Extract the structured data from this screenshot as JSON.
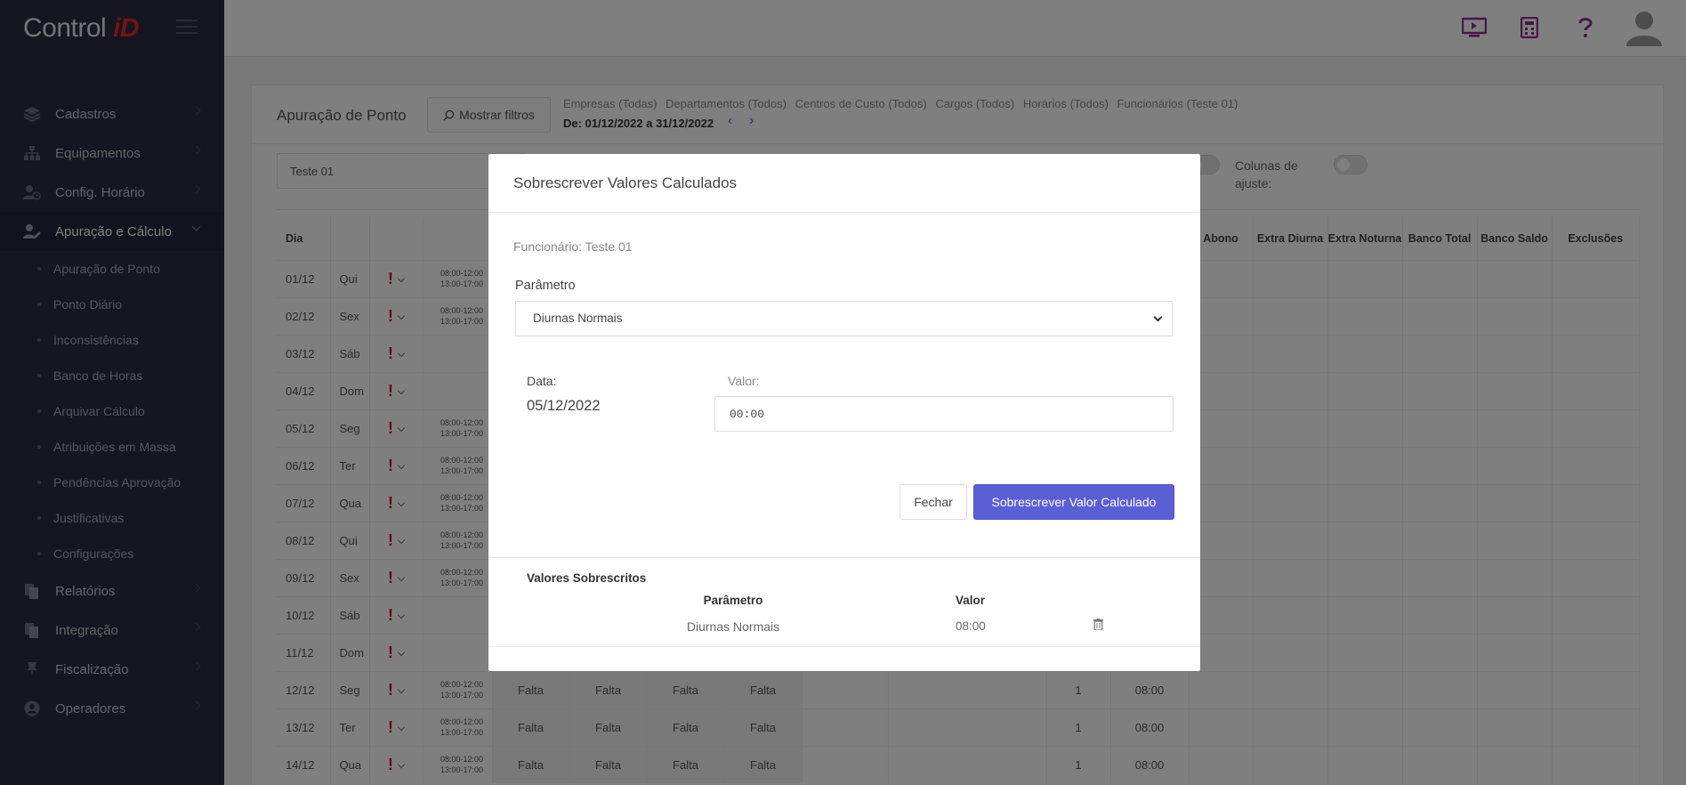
{
  "brand": {
    "name": "Control",
    "accent": "iD"
  },
  "sidebar": {
    "items": [
      {
        "label": "Cadastros",
        "icon": "layers-icon"
      },
      {
        "label": "Equipamentos",
        "icon": "network-icon"
      },
      {
        "label": "Config. Horário",
        "icon": "user-clock-icon"
      },
      {
        "label": "Apuração e Cálculo",
        "icon": "user-edit-icon",
        "active": true
      },
      {
        "label": "Relatórios",
        "icon": "files-icon"
      },
      {
        "label": "Integração",
        "icon": "files-icon"
      },
      {
        "label": "Fiscalização",
        "icon": "pin-icon"
      },
      {
        "label": "Operadores",
        "icon": "user-circle-icon"
      }
    ],
    "subitems": [
      "Apuração de Ponto",
      "Ponto Diário",
      "Inconsistências",
      "Banco de Horas",
      "Arquivar Cálculo",
      "Atribuições em Massa",
      "Pendências Aprovação",
      "Justificativas",
      "Configurações"
    ]
  },
  "topbar": {
    "icons": [
      "monitor-icon",
      "calculator-icon",
      "help-icon",
      "user-avatar-icon"
    ]
  },
  "page": {
    "title": "Apuração de Ponto",
    "filter_button": "Mostrar filtros",
    "filters": [
      "Empresas (Todas)",
      "Departamentos (Todos)",
      "Centros de Custo (Todos)",
      "Cargos (Todos)",
      "Horários (Todos)",
      "Funcionários (Teste 01)"
    ],
    "date_range": "De: 01/12/2022 a 31/12/2022",
    "employee": "Teste 01",
    "adjust_columns_label": "Colunas de ajuste:"
  },
  "table": {
    "headers": {
      "day": "Dia",
      "abono": "Abono",
      "extra_diurna": "Extra Diurna",
      "extra_noturna": "Extra Noturna",
      "banco_total": "Banco Total",
      "banco_saldo": "Banco Saldo",
      "exclusoes": "Exclusões"
    },
    "rows": [
      {
        "day": "01/12",
        "wd": "Qui",
        "hrs": [
          "08:00-12:00",
          "13:00-17:00"
        ]
      },
      {
        "day": "02/12",
        "wd": "Sex",
        "hrs": [
          "08:00-12:00",
          "13:00-17:00"
        ]
      },
      {
        "day": "03/12",
        "wd": "Sáb",
        "hrs": []
      },
      {
        "day": "04/12",
        "wd": "Dom",
        "hrs": []
      },
      {
        "day": "05/12",
        "wd": "Seg",
        "hrs": [
          "08:00-12:00",
          "13:00-17:00"
        ]
      },
      {
        "day": "06/12",
        "wd": "Ter",
        "hrs": [
          "08:00-12:00",
          "13:00-17:00"
        ]
      },
      {
        "day": "07/12",
        "wd": "Qua",
        "hrs": [
          "08:00-12:00",
          "13:00-17:00"
        ]
      },
      {
        "day": "08/12",
        "wd": "Qui",
        "hrs": [
          "08:00-12:00",
          "13:00-17:00"
        ]
      },
      {
        "day": "09/12",
        "wd": "Sex",
        "hrs": [
          "08:00-12:00",
          "13:00-17:00"
        ]
      },
      {
        "day": "10/12",
        "wd": "Sáb",
        "hrs": []
      },
      {
        "day": "11/12",
        "wd": "Dom",
        "hrs": []
      },
      {
        "day": "12/12",
        "wd": "Seg",
        "hrs": [
          "08:00-12:00",
          "13:00-17:00"
        ],
        "falta": [
          "Falta",
          "Falta",
          "Falta",
          "Falta"
        ],
        "count": "1",
        "total": "08:00"
      },
      {
        "day": "13/12",
        "wd": "Ter",
        "hrs": [
          "08:00-12:00",
          "13:00-17:00"
        ],
        "falta": [
          "Falta",
          "Falta",
          "Falta",
          "Falta"
        ],
        "count": "1",
        "total": "08:00"
      },
      {
        "day": "14/12",
        "wd": "Qua",
        "hrs": [
          "08:00-12:00",
          "13:00-17:00"
        ],
        "falta": [
          "Falta",
          "Falta",
          "Falta",
          "Falta"
        ],
        "count": "1",
        "total": "08:00"
      }
    ]
  },
  "modal": {
    "title": "Sobrescrever Valores Calculados",
    "employee_line": "Funcionário: Teste 01",
    "param_label": "Parâmetro",
    "param_value": "Diurnas Normais",
    "date_label": "Data:",
    "date_value": "05/12/2022",
    "valor_label": "Valor:",
    "valor_value": "00:00",
    "close_button": "Fechar",
    "submit_button": "Sobrescrever Valor Calculado",
    "overrides_title": "Valores Sobrescritos",
    "overrides_headers": {
      "param": "Parâmetro",
      "valor": "Valor"
    },
    "overrides": [
      {
        "param": "Diurnas Normais",
        "valor": "08:00"
      }
    ]
  },
  "colors": {
    "sidebar_bg": "#2a2d3e",
    "accent": "#5b5fd6",
    "brand_accent": "#e02b2b",
    "top_icon": "#8e2f8e",
    "falta": "#e0474c"
  }
}
